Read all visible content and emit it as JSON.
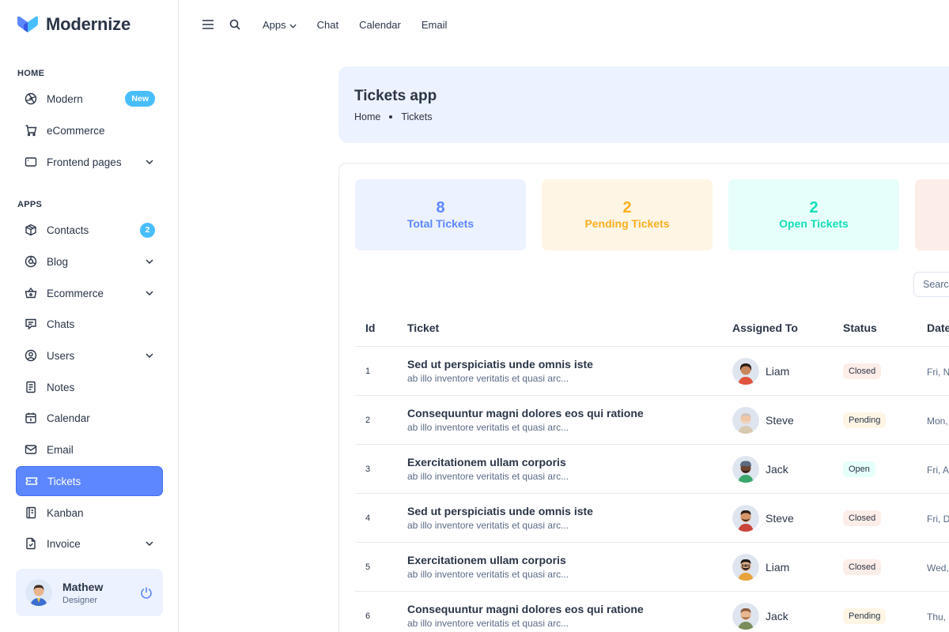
{
  "brand": {
    "name": "Modernize"
  },
  "sidebar": {
    "home_title": "HOME",
    "apps_title": "APPS",
    "items": [
      {
        "label": "Modern",
        "badge": "New",
        "icon": "aperture-icon"
      },
      {
        "label": "eCommerce",
        "icon": "shopping-cart-icon"
      },
      {
        "label": "Frontend pages",
        "icon": "app-window-icon"
      },
      {
        "label": "Contacts",
        "badge": "2",
        "icon": "package-icon"
      },
      {
        "label": "Blog",
        "icon": "chart-donut-icon"
      },
      {
        "label": "Ecommerce",
        "icon": "basket-icon"
      },
      {
        "label": "Chats",
        "icon": "message-icon"
      },
      {
        "label": "Users",
        "icon": "user-circle-icon"
      },
      {
        "label": "Notes",
        "icon": "notes-icon"
      },
      {
        "label": "Calendar",
        "icon": "calendar-icon"
      },
      {
        "label": "Email",
        "icon": "mail-icon"
      },
      {
        "label": "Tickets",
        "icon": "ticket-icon",
        "active": true
      },
      {
        "label": "Kanban",
        "icon": "notebook-icon"
      },
      {
        "label": "Invoice",
        "icon": "file-check-icon"
      }
    ],
    "profile": {
      "name": "Mathew",
      "role": "Designer"
    }
  },
  "header": {
    "links": [
      {
        "label": "Apps"
      },
      {
        "label": "Chat"
      },
      {
        "label": "Calendar"
      },
      {
        "label": "Email"
      }
    ]
  },
  "banner": {
    "title": "Tickets app",
    "breadcrumb": [
      "Home",
      "Tickets"
    ]
  },
  "stats": [
    {
      "value": "8",
      "label": "Total Tickets",
      "color": "#5d87ff",
      "bg": "#ecf2ff"
    },
    {
      "value": "2",
      "label": "Pending Tickets",
      "color": "#ffae1f",
      "bg": "#fef5e5"
    },
    {
      "value": "2",
      "label": "Open Tickets",
      "color": "#13deb9",
      "bg": "#e6fffa"
    }
  ],
  "search": {
    "placeholder": "Search"
  },
  "table": {
    "headers": [
      "Id",
      "Ticket",
      "Assigned To",
      "Status",
      "Date"
    ],
    "rows": [
      {
        "id": "1",
        "title": "Sed ut perspiciatis unde omnis iste",
        "subtitle": "ab illo inventore veritatis et quasi arc...",
        "assignee": "Liam",
        "status": "Closed",
        "date": "Fri, No"
      },
      {
        "id": "2",
        "title": "Consequuntur magni dolores eos qui ratione",
        "subtitle": "ab illo inventore veritatis et quasi arc...",
        "assignee": "Steve",
        "status": "Pending",
        "date": "Mon,"
      },
      {
        "id": "3",
        "title": "Exercitationem ullam corporis",
        "subtitle": "ab illo inventore veritatis et quasi arc...",
        "assignee": "Jack",
        "status": "Open",
        "date": "Fri, Au"
      },
      {
        "id": "4",
        "title": "Sed ut perspiciatis unde omnis iste",
        "subtitle": "ab illo inventore veritatis et quasi arc...",
        "assignee": "Steve",
        "status": "Closed",
        "date": "Fri, De"
      },
      {
        "id": "5",
        "title": "Exercitationem ullam corporis",
        "subtitle": "ab illo inventore veritatis et quasi arc...",
        "assignee": "Liam",
        "status": "Closed",
        "date": "Wed,"
      },
      {
        "id": "6",
        "title": "Consequuntur magni dolores eos qui ratione",
        "subtitle": "ab illo inventore veritatis et quasi arc...",
        "assignee": "Jack",
        "status": "Pending",
        "date": "Thu, J"
      }
    ]
  }
}
